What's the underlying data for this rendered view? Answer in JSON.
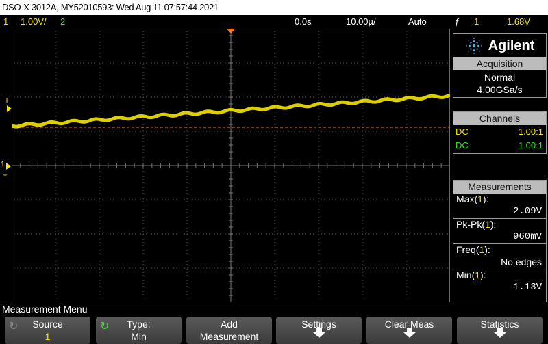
{
  "title_bar": "DSO-X 3012A, MY52010593: Wed Aug 11 07:57:44 2021",
  "status": {
    "ch1_num": "1",
    "ch1_scale": "1.00V/",
    "ch2_num": "2",
    "time_delay": "0.0s",
    "time_base": "10.00µ/",
    "trigger_mode": "Auto",
    "trigger_symbol": "ƒ",
    "trigger_source": "1",
    "trigger_level": "1.68V"
  },
  "left_markers": {
    "trigger": "T",
    "ch1": "1"
  },
  "brand": "Agilent",
  "acquisition": {
    "header": "Acquisition",
    "mode": "Normal",
    "rate": "4.00GSa/s"
  },
  "channels": {
    "header": "Channels",
    "rows": [
      {
        "coupling": "DC",
        "probe": "1.00:1"
      },
      {
        "coupling": "DC",
        "probe": "1.00:1"
      }
    ]
  },
  "measurements": {
    "header": "Measurements",
    "items": [
      {
        "name": "Max",
        "src": "1",
        "value": "2.09V"
      },
      {
        "name": "Pk-Pk",
        "src": "1",
        "value": "960mV"
      },
      {
        "name": "Freq",
        "src": "1",
        "value": "No edges"
      },
      {
        "name": "Min",
        "src": "1",
        "value": "1.13V"
      }
    ]
  },
  "menu_title": "Measurement Menu",
  "softkeys": [
    {
      "line1": "Source",
      "line2": "1"
    },
    {
      "line1": "Type:",
      "line2": "Min"
    },
    {
      "line1": "Add",
      "line2": "Measurement"
    },
    {
      "line1": "Settings",
      "line2": ""
    },
    {
      "line1": "Clear Meas",
      "line2": ""
    },
    {
      "line1": "Statistics",
      "line2": ""
    }
  ],
  "colors": {
    "ch1": "#f5e400",
    "ch2": "#3adf2a",
    "trigger_level_line": "#ff7a1a",
    "grid": "#555555"
  }
}
